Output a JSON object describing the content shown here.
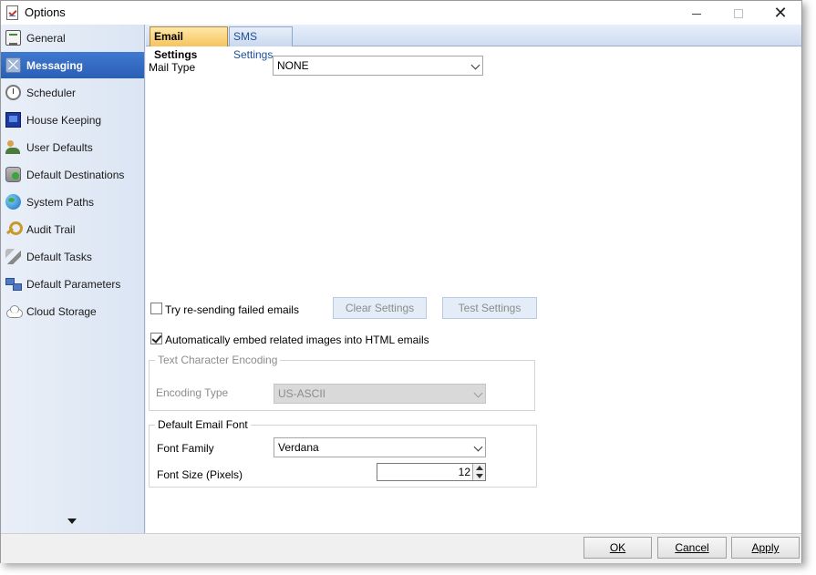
{
  "window": {
    "title": "Options",
    "icon": "checklist-icon"
  },
  "sidebar": {
    "items": [
      {
        "label": "General",
        "icon": "general-icon",
        "active": false
      },
      {
        "label": "Messaging",
        "icon": "messaging-icon",
        "active": true
      },
      {
        "label": "Scheduler",
        "icon": "clock-icon",
        "active": false
      },
      {
        "label": "House Keeping",
        "icon": "monitor-icon",
        "active": false
      },
      {
        "label": "User Defaults",
        "icon": "users-icon",
        "active": false
      },
      {
        "label": "Default Destinations",
        "icon": "database-icon",
        "active": false
      },
      {
        "label": "System Paths",
        "icon": "globe-icon",
        "active": false
      },
      {
        "label": "Audit Trail",
        "icon": "magnifier-icon",
        "active": false
      },
      {
        "label": "Default Tasks",
        "icon": "tools-icon",
        "active": false
      },
      {
        "label": "Default Parameters",
        "icon": "network-icon",
        "active": false
      },
      {
        "label": "Cloud Storage",
        "icon": "cloud-icon",
        "active": false
      }
    ]
  },
  "tabs": [
    {
      "label": "Email Settings",
      "active": true
    },
    {
      "label": "SMS Settings",
      "active": false
    }
  ],
  "email": {
    "mail_type_label": "Mail Type",
    "mail_type_value": "NONE",
    "retry_label": "Try re-sending failed emails",
    "retry_checked": false,
    "clear_settings_label": "Clear Settings",
    "test_settings_label": "Test Settings",
    "embed_images_label": "Automatically embed related images into HTML emails",
    "embed_images_checked": true,
    "encoding_group_label": "Text Character Encoding",
    "encoding_type_label": "Encoding Type",
    "encoding_type_value": "US-ASCII",
    "font_group_label": "Default Email Font",
    "font_family_label": "Font Family",
    "font_family_value": "Verdana",
    "font_size_label": "Font Size (Pixels)",
    "font_size_value": "12"
  },
  "footer": {
    "ok_label": "OK",
    "cancel_label": "Cancel",
    "apply_label": "Apply"
  }
}
